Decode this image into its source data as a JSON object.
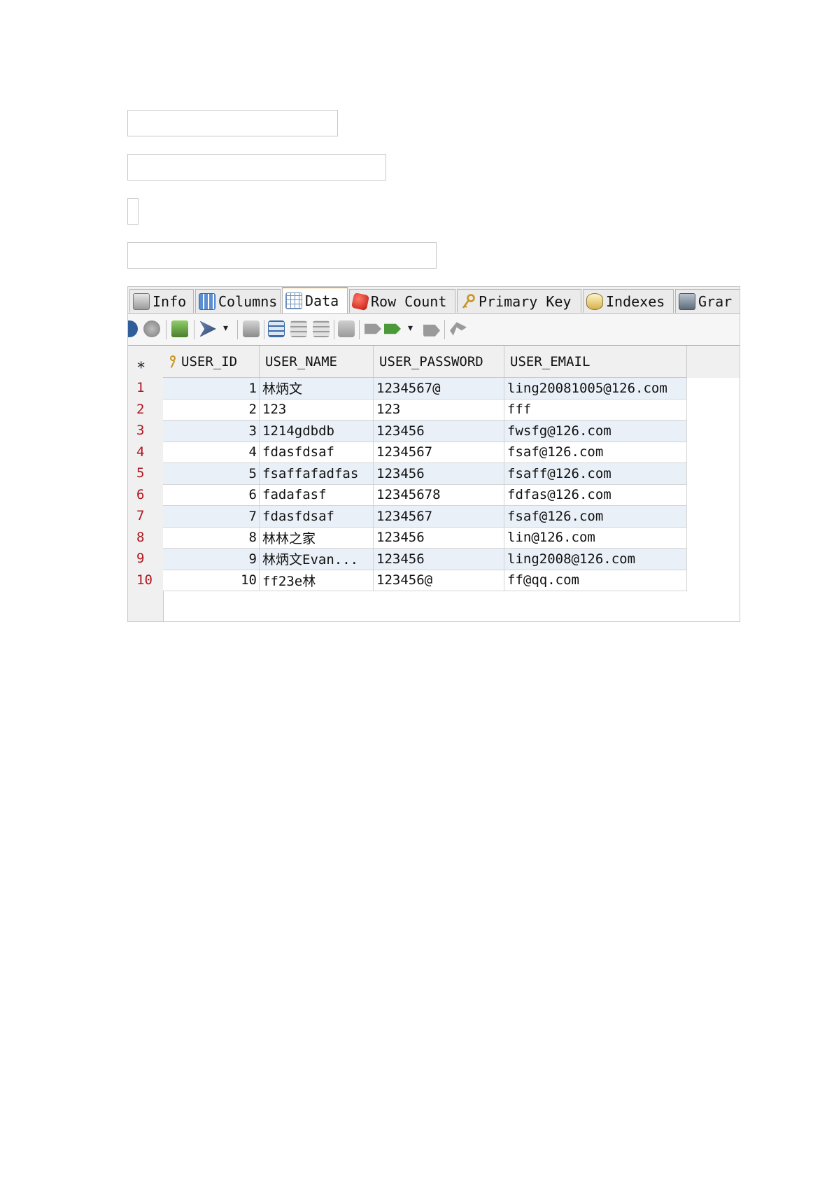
{
  "tabs": [
    {
      "label": "Info",
      "icon": "info-icon"
    },
    {
      "label": "Columns",
      "icon": "columns-icon"
    },
    {
      "label": "Data",
      "icon": "data-grid-icon",
      "active": true
    },
    {
      "label": "Row Count",
      "icon": "dice-icon"
    },
    {
      "label": "Primary Key",
      "icon": "key-icon"
    },
    {
      "label": "Indexes",
      "icon": "indexes-icon"
    },
    {
      "label": "Grar",
      "icon": "grants-icon"
    }
  ],
  "toolbar": {
    "icons": [
      "refresh-icon",
      "stop-icon",
      "export-icon",
      "filter-icon",
      "copy-icon",
      "grid-add-icon",
      "grid-edit-icon",
      "grid-delete-icon",
      "form-icon",
      "commit-icon",
      "rollback-icon",
      "tool-icon",
      "undo-icon"
    ]
  },
  "grid": {
    "columns": [
      "USER_ID",
      "USER_NAME",
      "USER_PASSWORD",
      "USER_EMAIL"
    ],
    "new_row_marker": "*",
    "rows": [
      {
        "num": "1",
        "id": "1",
        "name": "林炳文",
        "password": "1234567@",
        "email": "ling20081005@126.com"
      },
      {
        "num": "2",
        "id": "2",
        "name": "123",
        "password": "123",
        "email": "fff"
      },
      {
        "num": "3",
        "id": "3",
        "name": "1214gdbdb",
        "password": "123456",
        "email": "fwsfg@126.com"
      },
      {
        "num": "4",
        "id": "4",
        "name": "fdasfdsaf",
        "password": "1234567",
        "email": "fsaf@126.com"
      },
      {
        "num": "5",
        "id": "5",
        "name": "fsaffafadfas",
        "password": "123456",
        "email": "fsaff@126.com"
      },
      {
        "num": "6",
        "id": "6",
        "name": "fadafasf",
        "password": "12345678",
        "email": "fdfas@126.com"
      },
      {
        "num": "7",
        "id": "7",
        "name": "fdasfdsaf",
        "password": "1234567",
        "email": "fsaf@126.com"
      },
      {
        "num": "8",
        "id": "8",
        "name": "林林之家",
        "password": "123456",
        "email": "lin@126.com"
      },
      {
        "num": "9",
        "id": "9",
        "name": "林炳文Evan...",
        "password": "123456",
        "email": "ling2008@126.com"
      },
      {
        "num": "10",
        "id": "10",
        "name": "ff23e林",
        "password": "123456@",
        "email": "ff@qq.com"
      }
    ]
  }
}
